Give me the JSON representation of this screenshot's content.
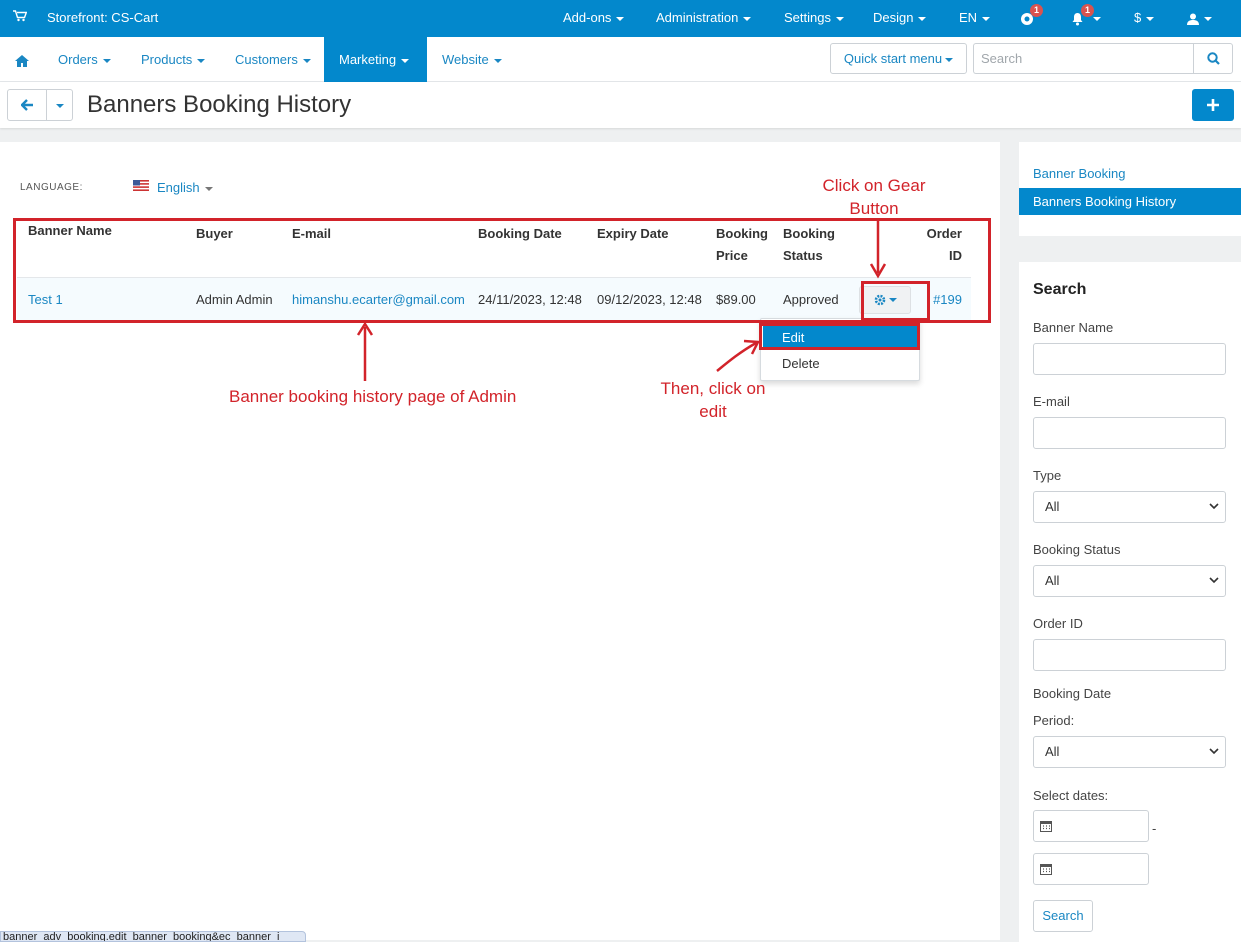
{
  "topbar": {
    "store_label": "Storefront: CS-Cart",
    "addons": "Add-ons",
    "administration": "Administration",
    "settings": "Settings",
    "design": "Design",
    "language": "EN",
    "notif_count_1": "1",
    "notif_count_2": "1",
    "currency": "$"
  },
  "nav": {
    "orders": "Orders",
    "products": "Products",
    "customers": "Customers",
    "marketing": "Marketing",
    "website": "Website",
    "quick_start": "Quick start menu",
    "search_placeholder": "Search"
  },
  "page": {
    "title": "Banners Booking History"
  },
  "content": {
    "language_label": "LANGUAGE:",
    "language_value": "English"
  },
  "table": {
    "headers": [
      "Banner Name",
      "Buyer",
      "E-mail",
      "Booking Date",
      "Expiry Date",
      "Booking",
      "Price",
      "Booking",
      "Status",
      "Order",
      "ID"
    ],
    "rows": [
      {
        "banner_name": "Test 1",
        "buyer": "Admin Admin",
        "email": "himanshu.ecarter@gmail.com",
        "booking_date": "24/11/2023, 12:48",
        "expiry_date": "09/12/2023, 12:48",
        "price": "$89.00",
        "status": "Approved",
        "order_id": "#199"
      }
    ]
  },
  "dropdown": {
    "edit": "Edit",
    "delete": "Delete"
  },
  "annotations": {
    "gear_line1": "Click on Gear",
    "gear_line2": "Button",
    "page_note": "Banner booking history page of Admin",
    "edit_line1": "Then, click on",
    "edit_line2": "edit",
    "color": "#d2232a"
  },
  "sidebar": {
    "links": [
      "Banner Booking",
      "Banners Booking History"
    ],
    "search_title": "Search",
    "banner_name_label": "Banner Name",
    "email_label": "E-mail",
    "type_label": "Type",
    "type_value": "All",
    "status_label": "Booking Status",
    "status_value": "All",
    "order_label": "Order ID",
    "date_label": "Booking Date",
    "period_label": "Period:",
    "period_value": "All",
    "select_dates_label": "Select dates:",
    "dash": "-",
    "search_button": "Search"
  },
  "statusbar": {
    "url": "banner_adv_booking.edit_banner_booking&ec_banner_i"
  },
  "colors": {
    "primary": "#0388cc",
    "link": "#1a87c3"
  }
}
